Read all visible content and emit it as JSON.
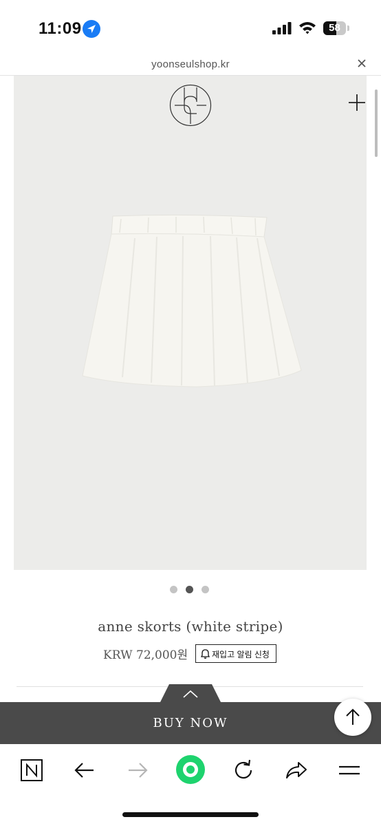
{
  "status_bar": {
    "time": "11:09",
    "battery_level": "58",
    "icons": [
      "location-arrow-icon",
      "signal-icon",
      "wifi-icon",
      "battery-icon"
    ]
  },
  "url_bar": {
    "url": "yoonseulshop.kr",
    "close_icon": "close-icon"
  },
  "gallery": {
    "image_count": 3,
    "active_index": 1,
    "background": "#ececea"
  },
  "product": {
    "title": "anne skorts (white stripe)",
    "price": "KRW 72,000원",
    "restock_button": "재입고 알림 신청"
  },
  "buy_bar": {
    "label": "BUY NOW",
    "color": "#4a4a4a"
  },
  "toolbar": {
    "items": [
      "naver-n-icon",
      "back-arrow-icon",
      "forward-arrow-icon",
      "green-home-icon",
      "refresh-icon",
      "share-icon",
      "menu-icon"
    ],
    "accent": "#1ed36e"
  }
}
